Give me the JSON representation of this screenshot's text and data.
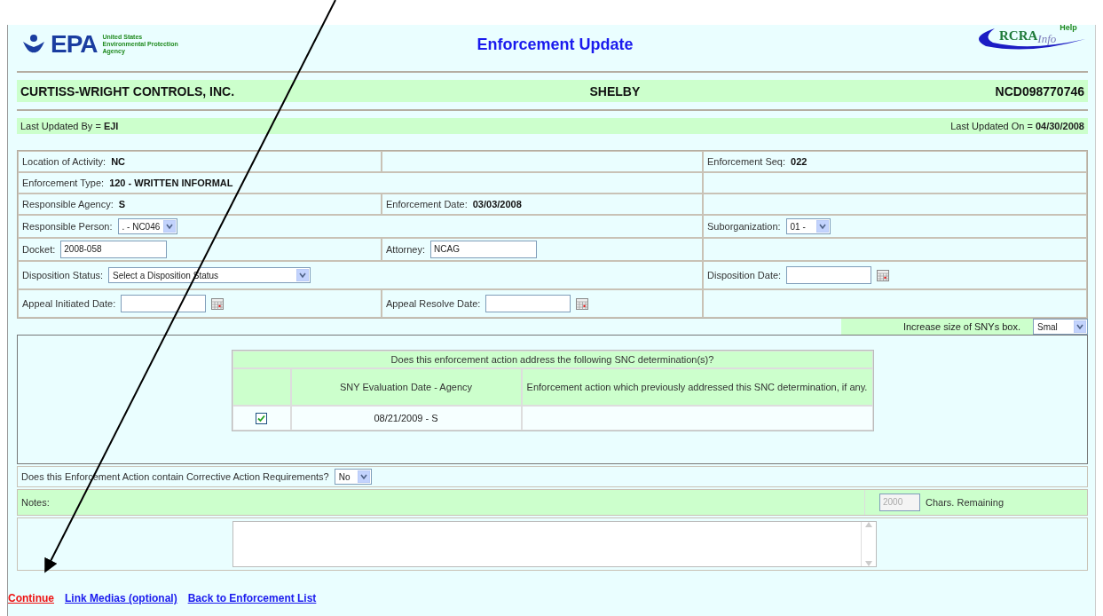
{
  "header": {
    "logo_letters": "EPA",
    "agency_lines": [
      "United States",
      "Environmental Protection",
      "Agency"
    ],
    "title": "Enforcement Update",
    "help_logo": {
      "name": "RCRA",
      "script": "Info",
      "help": "Help"
    }
  },
  "facility": {
    "name": "CURTISS-WRIGHT CONTROLS, INC.",
    "city": "SHELBY",
    "id": "NCD098770746"
  },
  "update_bar": {
    "left": "Last Updated By = **EJI**",
    "right": "Last Updated On = **04/30/2008**"
  },
  "form_rows": [
    [
      {
        "kind": "text",
        "label": "Location of Activity:",
        "value": "NC"
      },
      {
        "kind": "empty"
      },
      {
        "kind": "text",
        "label": "Enforcement Seq:",
        "value": "022"
      }
    ],
    [
      {
        "kind": "text",
        "label": "Enforcement Type:",
        "value": "120 - WRITTEN INFORMAL",
        "wide": true
      },
      {
        "kind": "empty"
      }
    ],
    [
      {
        "kind": "text",
        "label": "Responsible Agency:",
        "value": "S"
      },
      {
        "kind": "text",
        "label": "Enforcement Date:",
        "value": "03/03/2008"
      },
      {
        "kind": "empty"
      }
    ],
    [
      {
        "kind": "select",
        "label": "Responsible Person:",
        "value": ". - NC046",
        "wide": true
      },
      {
        "kind": "select",
        "label": "Suborganization:",
        "value": "01 -"
      }
    ],
    [
      {
        "kind": "input",
        "label": "Docket:",
        "value": "2008-058"
      },
      {
        "kind": "input",
        "label": "Attorney:",
        "value": "NCAG"
      },
      {
        "kind": "empty"
      }
    ],
    [
      {
        "kind": "select",
        "label": "Disposition Status:",
        "value": "Select a Disposition Status",
        "wide": true
      },
      {
        "kind": "date",
        "label": "Disposition Date:"
      }
    ],
    [
      {
        "kind": "date",
        "label": "Appeal Initiated Date:"
      },
      {
        "kind": "date",
        "label": "Appeal Resolve Date:"
      },
      {
        "kind": "empty"
      }
    ]
  ],
  "sny_size": {
    "label": "Increase size of SNYs box.",
    "value": "Smal"
  },
  "snc_table": {
    "title": "Does this enforcement action address the following SNC determination(s)?",
    "columns": [
      "SNY Evaluation Date - Agency",
      "Enforcement action which previously addressed this SNC determination, if any."
    ],
    "rows": [
      {
        "checked": true,
        "date_agency": "08/21/2009 - S"
      }
    ]
  },
  "corrective": {
    "question": "Does this Enforcement Action contain Corrective Action Requirements?",
    "value": "No"
  },
  "notes": {
    "label": "Notes:",
    "chars_remaining": "2000",
    "disabled": true,
    "chars_label": "Chars. Remaining"
  },
  "links": [
    {
      "label": "Continue",
      "kind": "primary"
    },
    {
      "label": "Link Medias (optional)",
      "kind": "normal"
    },
    {
      "label": "Back to Enforcement List",
      "kind": "normal"
    }
  ]
}
